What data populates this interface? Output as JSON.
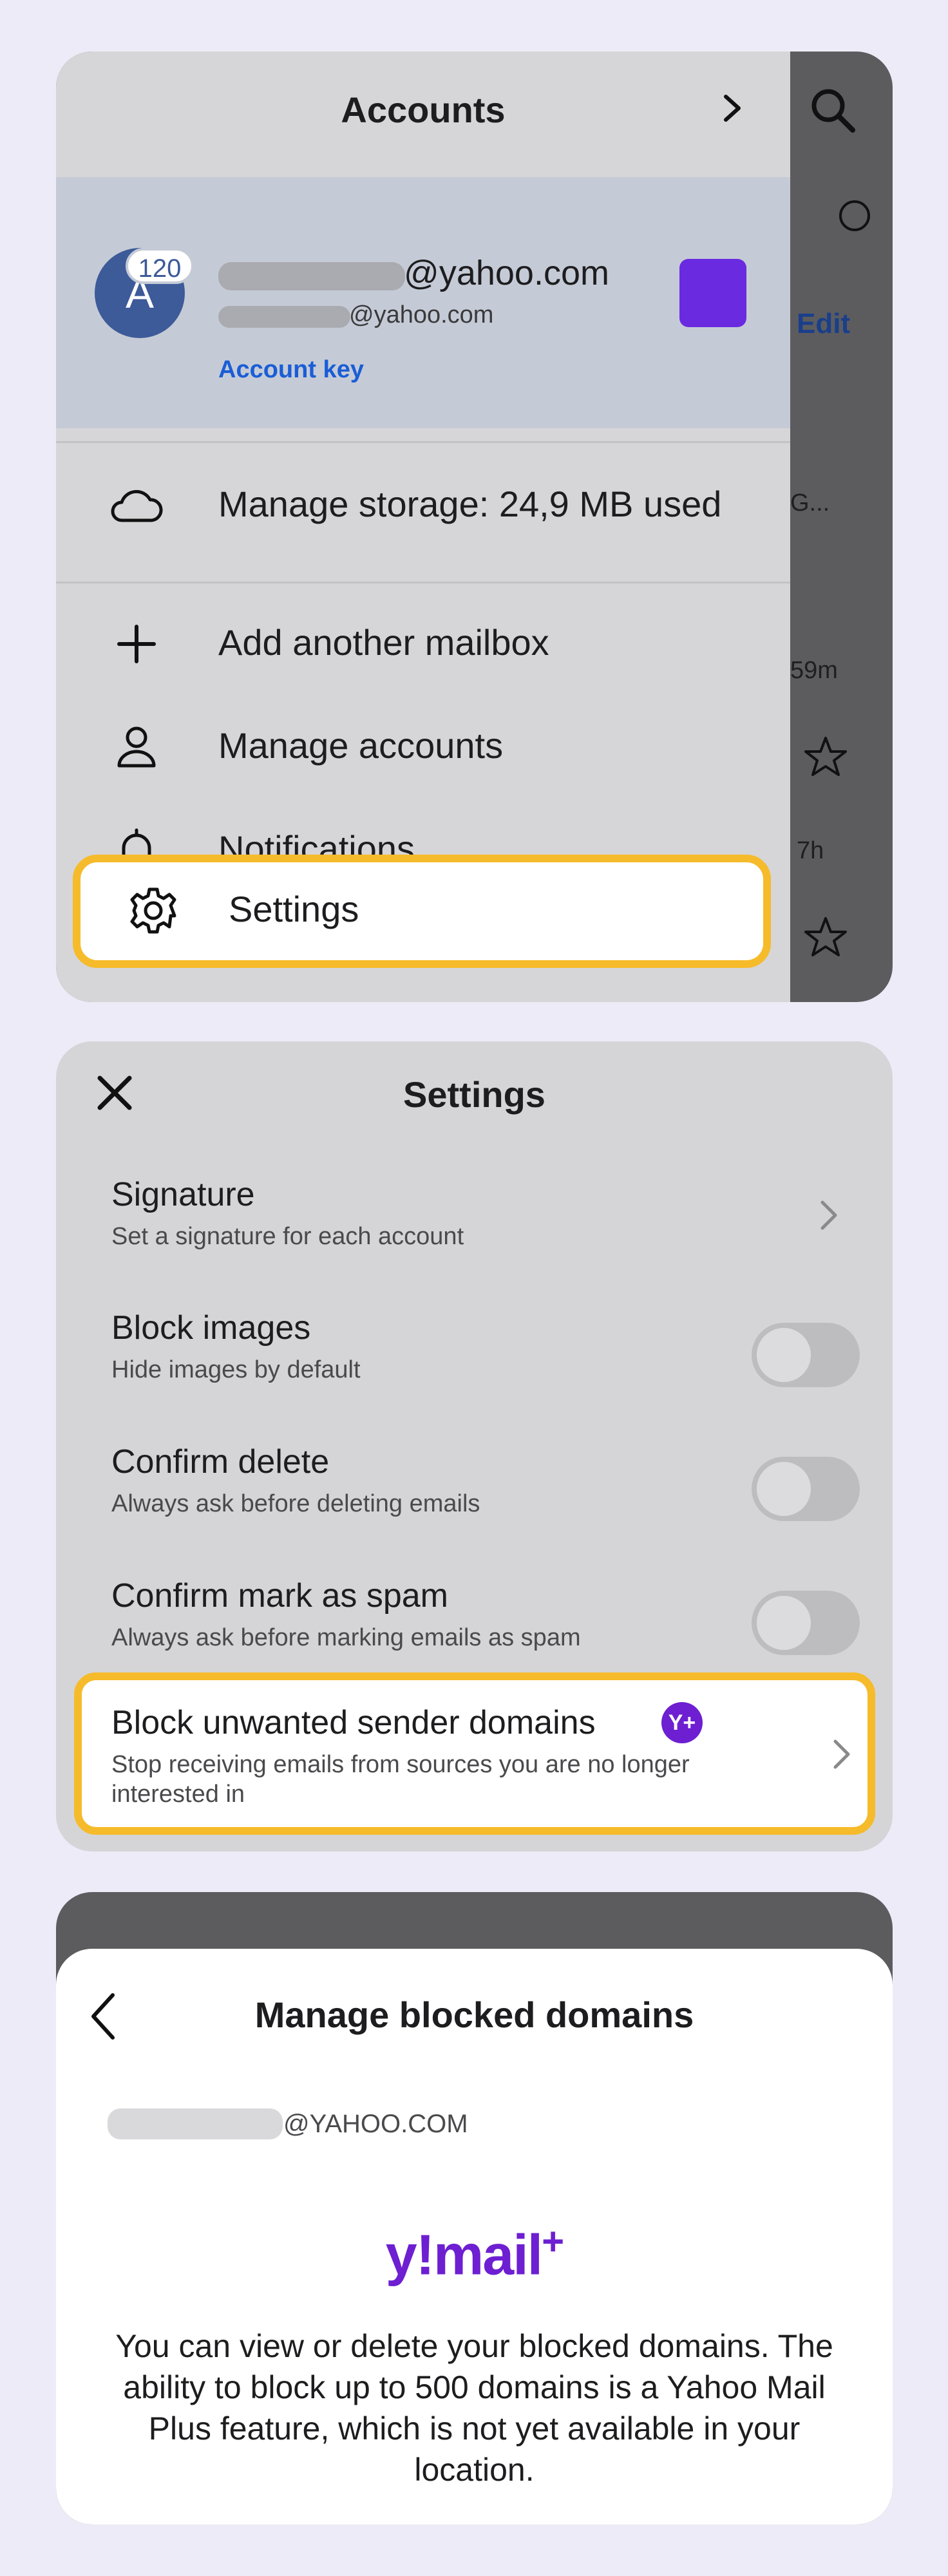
{
  "accounts_panel": {
    "title": "Accounts",
    "avatar_letter": "A",
    "unread_badge": "120",
    "primary_email_suffix": "@yahoo.com",
    "secondary_email_suffix": "@yahoo.com",
    "account_key_link": "Account key",
    "account_color": "#6a2ae0",
    "menu": [
      {
        "label": "Manage storage: 24,9 MB used",
        "icon": "cloud-icon"
      },
      {
        "label": "Add another mailbox",
        "icon": "plus-icon"
      },
      {
        "label": "Manage accounts",
        "icon": "person-icon"
      },
      {
        "label": "Notifications",
        "icon": "bell-icon"
      },
      {
        "label": "Settings",
        "icon": "gear-icon"
      }
    ],
    "background_list": {
      "edit_label": "Edit",
      "snippet": "G...",
      "time_1": "59m",
      "time_2": "7h"
    }
  },
  "settings_panel": {
    "title": "Settings",
    "rows": [
      {
        "title": "Signature",
        "description": "Set a signature for each account",
        "control": "chevron"
      },
      {
        "title": "Block images",
        "description": "Hide images by default",
        "control": "toggle",
        "on": false
      },
      {
        "title": "Confirm delete",
        "description": "Always ask before deleting emails",
        "control": "toggle",
        "on": false
      },
      {
        "title": "Confirm mark as spam",
        "description": "Always ask before marking emails as spam",
        "control": "toggle",
        "on": false
      },
      {
        "title": "Block unwanted sender domains",
        "description": "Stop receiving emails from sources you are no longer interested in",
        "control": "chevron",
        "badge": "Y+"
      }
    ]
  },
  "blocked_domains_panel": {
    "title": "Manage blocked domains",
    "account_suffix": "@YAHOO.COM",
    "logo_text": "y!mail",
    "logo_plus": "+",
    "message": "You can view or delete your blocked domains. The ability to block up to 500 domains is a Yahoo Mail Plus feature, which is not yet available in your location."
  },
  "colors": {
    "highlight": "#f6bb2a",
    "brand_purple": "#6d1fd1",
    "link_blue": "#1a5dd6"
  }
}
